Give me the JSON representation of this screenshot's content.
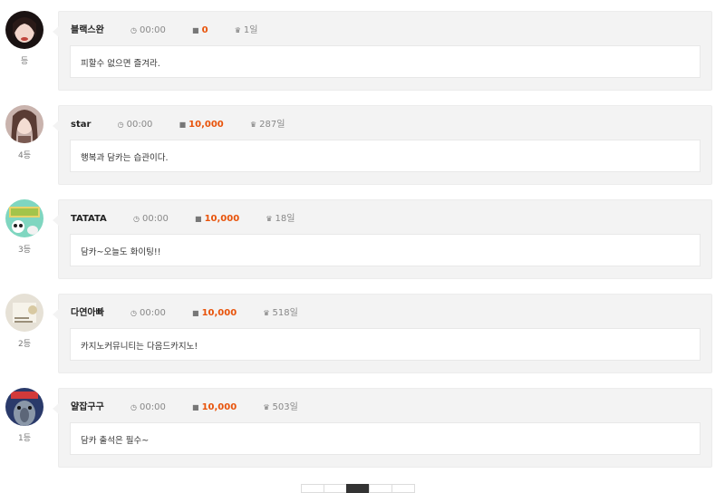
{
  "comments": [
    {
      "name": "블랙스완",
      "time": "00:00",
      "points": "0",
      "days": "1일",
      "rank": "등",
      "message": "피할수 없으면 즐겨라."
    },
    {
      "name": "star",
      "time": "00:00",
      "points": "10,000",
      "days": "287일",
      "rank": "4등",
      "message": "행복과 담카는 습관이다."
    },
    {
      "name": "TATATA",
      "time": "00:00",
      "points": "10,000",
      "days": "18일",
      "rank": "3등",
      "message": "담카~오늘도 화이팅!!"
    },
    {
      "name": "다연아빠",
      "time": "00:00",
      "points": "10,000",
      "days": "518일",
      "rank": "2등",
      "message": "카지노커뮤니티는 다음드카지노!"
    },
    {
      "name": "얄잡구구",
      "time": "00:00",
      "points": "10,000",
      "days": "503일",
      "rank": "1등",
      "message": "담카 출석은 필수~"
    }
  ],
  "icons": {
    "time": "clock-icon",
    "points": "gift-icon",
    "days": "trophy-icon"
  },
  "colors": {
    "points_accent": "#e8530a",
    "card_bg": "#f3f3f3",
    "active_page": "#333333"
  },
  "pagination": {
    "active_page_index": 2
  }
}
